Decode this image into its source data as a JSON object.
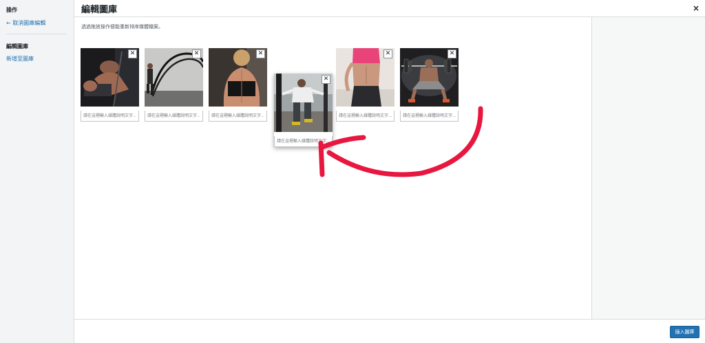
{
  "sidebar": {
    "actions_heading": "操作",
    "cancel_link": "← 取消圖庫編輯",
    "gallery_heading": "編輯圖庫",
    "add_link": "新增至圖庫"
  },
  "header": {
    "title": "編輯圖庫",
    "close": "×"
  },
  "main": {
    "instructions": "透過拖放操作便能重新排序媒體檔案。",
    "caption_placeholder": "請在這裡輸入媒體說明文字...",
    "remove_symbol": "✕",
    "attachments": [
      {
        "subject": "athlete pulling cable"
      },
      {
        "subject": "battle ropes"
      },
      {
        "subject": "woman back muscles"
      },
      {
        "subject": "man pushing sled"
      },
      {
        "subject": "woman abs"
      },
      {
        "subject": "barbell squat"
      }
    ]
  },
  "toolbar": {
    "insert_label": "插入圖庫"
  },
  "annotation": {
    "arrow_color": "#e8173f"
  },
  "colors": {
    "accent": "#2271b1"
  }
}
